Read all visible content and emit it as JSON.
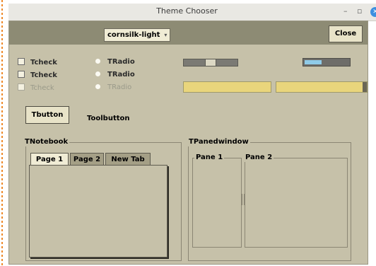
{
  "window": {
    "title": "Theme Chooser",
    "controls": {
      "minimize": "–",
      "maximize": "▫",
      "close": "✕"
    }
  },
  "toolbar": {
    "theme_combo_value": "cornsilk-light",
    "close_label": "Close"
  },
  "checks": [
    {
      "label": "Tcheck",
      "disabled": false
    },
    {
      "label": "Tcheck",
      "disabled": false
    },
    {
      "label": "Tcheck",
      "disabled": true
    }
  ],
  "radios": [
    {
      "label": "TRadio",
      "disabled": false
    },
    {
      "label": "TRadio",
      "disabled": false
    },
    {
      "label": "TRadio",
      "disabled": true
    }
  ],
  "buttons": {
    "tbutton": "Tbutton",
    "toolbutton": "Toolbutton"
  },
  "notebook": {
    "legend": "TNotebook",
    "tabs": [
      {
        "label": "Page 1",
        "selected": true
      },
      {
        "label": "Page 2",
        "selected": false
      },
      {
        "label": "New Tab",
        "selected": false
      }
    ]
  },
  "panedwindow": {
    "legend": "TPanedwindow",
    "panes": [
      "Pane 1",
      "Pane 2"
    ]
  },
  "colors": {
    "window_bg": "#c6c1a9",
    "topbar_bg": "#8d8b74",
    "entry_bg": "#e9d57c",
    "progress_fill": "#8fcbe8"
  }
}
